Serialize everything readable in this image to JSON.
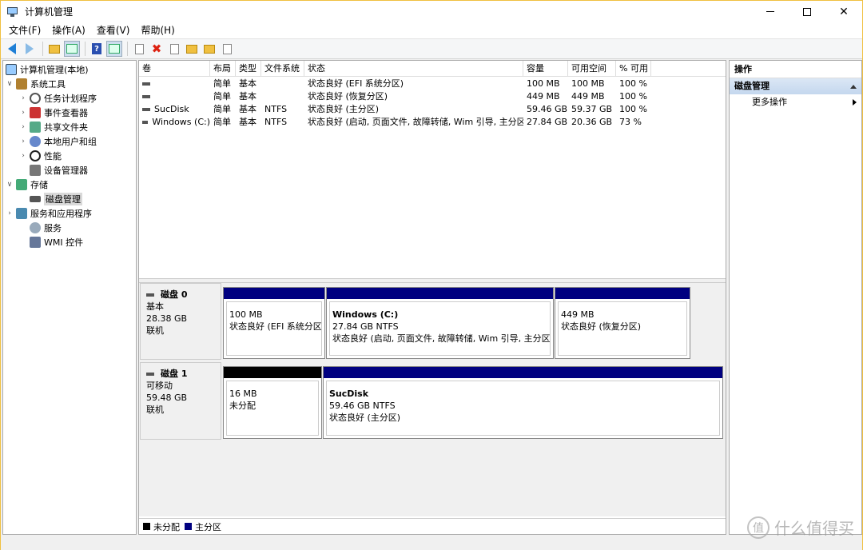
{
  "window": {
    "title": "计算机管理"
  },
  "menu": [
    "文件(F)",
    "操作(A)",
    "查看(V)",
    "帮助(H)"
  ],
  "tree": {
    "root": "计算机管理(本地)",
    "system_tools": "系统工具",
    "task_scheduler": "任务计划程序",
    "event_viewer": "事件查看器",
    "shared_folders": "共享文件夹",
    "local_users": "本地用户和组",
    "performance": "性能",
    "device_manager": "设备管理器",
    "storage": "存储",
    "disk_management": "磁盘管理",
    "services_apps": "服务和应用程序",
    "services": "服务",
    "wmi": "WMI 控件"
  },
  "volumes": {
    "headers": [
      "卷",
      "布局",
      "类型",
      "文件系统",
      "状态",
      "容量",
      "可用空间",
      "% 可用"
    ],
    "rows": [
      [
        "",
        "简单",
        "基本",
        "",
        "状态良好 (EFI 系统分区)",
        "100 MB",
        "100 MB",
        "100 %"
      ],
      [
        "",
        "简单",
        "基本",
        "",
        "状态良好 (恢复分区)",
        "449 MB",
        "449 MB",
        "100 %"
      ],
      [
        "SucDisk",
        "简单",
        "基本",
        "NTFS",
        "状态良好 (主分区)",
        "59.46 GB",
        "59.37 GB",
        "100 %"
      ],
      [
        "Windows (C:)",
        "简单",
        "基本",
        "NTFS",
        "状态良好 (启动, 页面文件, 故障转储, Wim 引导, 主分区)",
        "27.84 GB",
        "20.36 GB",
        "73 %"
      ]
    ]
  },
  "disks": [
    {
      "name": "磁盘 0",
      "type": "基本",
      "size": "28.38 GB",
      "status": "联机",
      "partitions": [
        {
          "name": "",
          "size": "100 MB",
          "status": "状态良好 (EFI 系统分区)"
        },
        {
          "name": "Windows  (C:)",
          "size": "27.84 GB NTFS",
          "status": "状态良好 (启动, 页面文件, 故障转储, Wim 引导, 主分区)"
        },
        {
          "name": "",
          "size": "449 MB",
          "status": "状态良好 (恢复分区)"
        }
      ]
    },
    {
      "name": "磁盘 1",
      "type": "可移动",
      "size": "59.48 GB",
      "status": "联机",
      "partitions": [
        {
          "name": "",
          "size": "16 MB",
          "status": "未分配"
        },
        {
          "name": "SucDisk",
          "size": "59.46 GB NTFS",
          "status": "状态良好 (主分区)"
        }
      ]
    }
  ],
  "legend": {
    "unallocated": "未分配",
    "primary": "主分区"
  },
  "actions": {
    "title": "操作",
    "section": "磁盘管理",
    "more": "更多操作"
  },
  "watermark": "什么值得买",
  "colors": {
    "primary_partition": "#000080",
    "unallocated": "#000000"
  }
}
